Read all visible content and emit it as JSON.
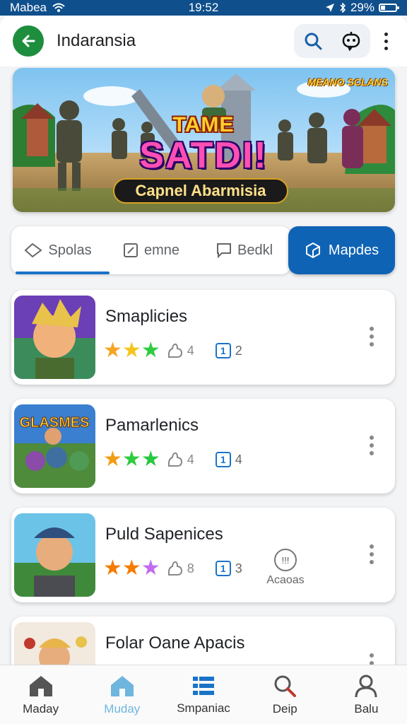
{
  "status": {
    "carrier": "Mabea",
    "time": "19:52",
    "battery": "29%",
    "battery_level": 0.29
  },
  "header": {
    "title": "Indaransia"
  },
  "banner": {
    "corner_text": "MEANO SCLANS",
    "title_line1": "TAME",
    "title_line2": "SATDI!",
    "caption": "Capnel Abarmisia"
  },
  "tabs": [
    {
      "label": "Spolas",
      "icon": "tag-icon"
    },
    {
      "label": "emne",
      "icon": "edit-box-icon"
    },
    {
      "label": "Bedkl",
      "icon": "chat-bubble-icon"
    }
  ],
  "active_tab": {
    "label": "Mapdes",
    "icon": "cube-icon"
  },
  "list": [
    {
      "name": "Smaplicies",
      "stars": [
        "#f5a623",
        "#f5c51d",
        "#2ecc40"
      ],
      "count1": "4",
      "count2": "2"
    },
    {
      "name": "Pamarlenics",
      "stars": [
        "#f39c12",
        "#2ecc40",
        "#27c93f"
      ],
      "count1": "4",
      "count2": "4",
      "thumb_text": "GLASMES"
    },
    {
      "name": "Puld Sapenices",
      "stars": [
        "#f57c00",
        "#f57c00",
        "#c26bf0"
      ],
      "count1": "8",
      "count2": "3",
      "extra_label": "Acaoas",
      "extra_icon_text": "!!!"
    },
    {
      "name": "Folar Oane Apacis"
    }
  ],
  "bottom_nav": [
    {
      "label": "Maday",
      "icon": "home-icon"
    },
    {
      "label": "Muday",
      "icon": "home-icon",
      "active": true
    },
    {
      "label": "Smpaniac",
      "icon": "list-icon"
    },
    {
      "label": "Deip",
      "icon": "search-icon"
    },
    {
      "label": "Balu",
      "icon": "person-icon"
    }
  ],
  "colors": {
    "accent": "#0f63b5",
    "back_button": "#1e8e3e",
    "status_bar": "#0f4f8c"
  }
}
